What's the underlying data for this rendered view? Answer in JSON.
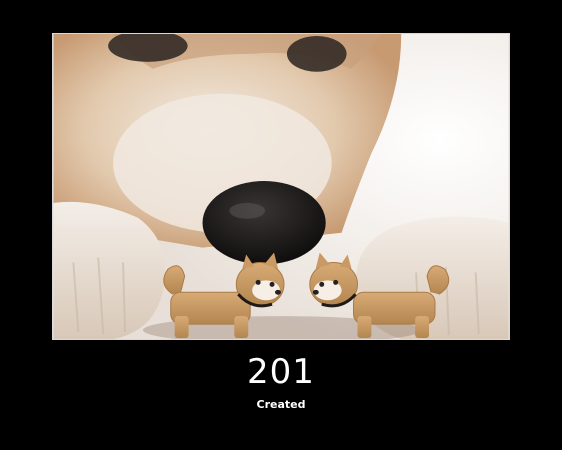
{
  "status": {
    "code": "201",
    "label": "Created"
  },
  "image": {
    "subject": "shiba-dog-with-two-toy-dog-figurines",
    "colors": {
      "background": "#000000",
      "frame": "#d9d9d9",
      "text": "#ffffff",
      "fur_light": "#efe6dc",
      "fur_tan": "#d9b48f",
      "nose": "#1d1a1a",
      "figurine": "#c99a63"
    }
  }
}
